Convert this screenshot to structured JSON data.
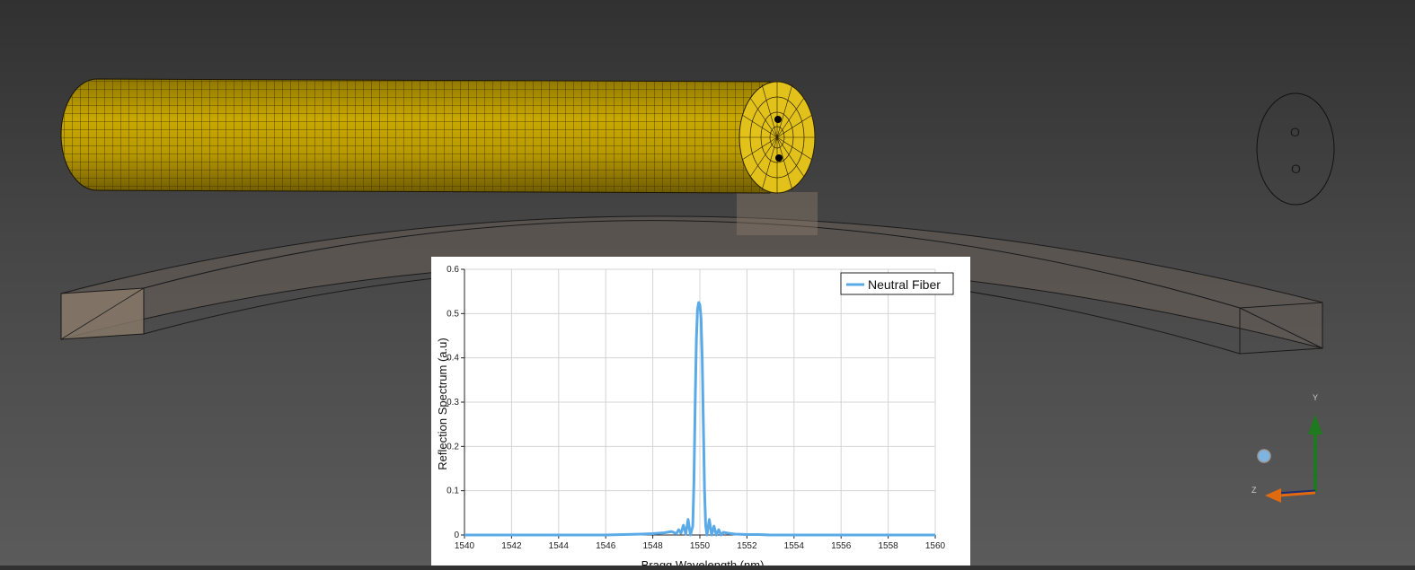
{
  "scene": {
    "colors": {
      "fiber": "#c9a800",
      "fiber_end": "#e2c11a",
      "beam_fill": "#8a7a6a",
      "triad_y": "#1f7a1f",
      "triad_z": "#e06a10",
      "triad_x": "#1c2e6e",
      "triad_sphere": "#7fb3e0"
    },
    "end_view": {
      "port_top": "O",
      "port_bottom": "O"
    },
    "triad": {
      "y_label": "Y",
      "z_label": "Z"
    }
  },
  "chart_data": {
    "type": "line",
    "xlabel": "Bragg Wavelength (nm)",
    "ylabel": "Reflection Spectrum (a.u)",
    "xlim": [
      1540,
      1560
    ],
    "ylim": [
      0,
      0.6
    ],
    "xticks": [
      1540,
      1542,
      1544,
      1546,
      1548,
      1550,
      1552,
      1554,
      1556,
      1558,
      1560
    ],
    "yticks": [
      0,
      0.1,
      0.2,
      0.3,
      0.4,
      0.5,
      0.6
    ],
    "ytick_labels": [
      "0",
      "0.1",
      "0.2",
      "0.3",
      "0.4",
      "0.5",
      "0.6"
    ],
    "grid": true,
    "legend_position": "top-right",
    "series": [
      {
        "name": "Neutral Fiber",
        "color": "#5aaae8",
        "x": [
          1540,
          1546,
          1547.5,
          1548,
          1548.5,
          1548.8,
          1549.0,
          1549.1,
          1549.2,
          1549.3,
          1549.4,
          1549.5,
          1549.6,
          1549.7,
          1549.75,
          1549.8,
          1549.85,
          1549.9,
          1549.95,
          1550.0,
          1550.05,
          1550.1,
          1550.15,
          1550.2,
          1550.25,
          1550.3,
          1550.4,
          1550.5,
          1550.6,
          1550.7,
          1550.8,
          1550.9,
          1551.0,
          1551.2,
          1551.5,
          1552,
          1552.5,
          1553,
          1560
        ],
        "y": [
          0,
          0,
          0.002,
          0.003,
          0.005,
          0.008,
          0.003,
          0.012,
          0.004,
          0.022,
          0.002,
          0.035,
          0.0,
          0.02,
          0.12,
          0.3,
          0.44,
          0.51,
          0.525,
          0.52,
          0.49,
          0.4,
          0.25,
          0.1,
          0.02,
          0.0,
          0.035,
          0.0,
          0.02,
          0.0,
          0.012,
          0.0,
          0.006,
          0.004,
          0.002,
          0.001,
          0.001,
          0,
          0
        ]
      }
    ]
  }
}
